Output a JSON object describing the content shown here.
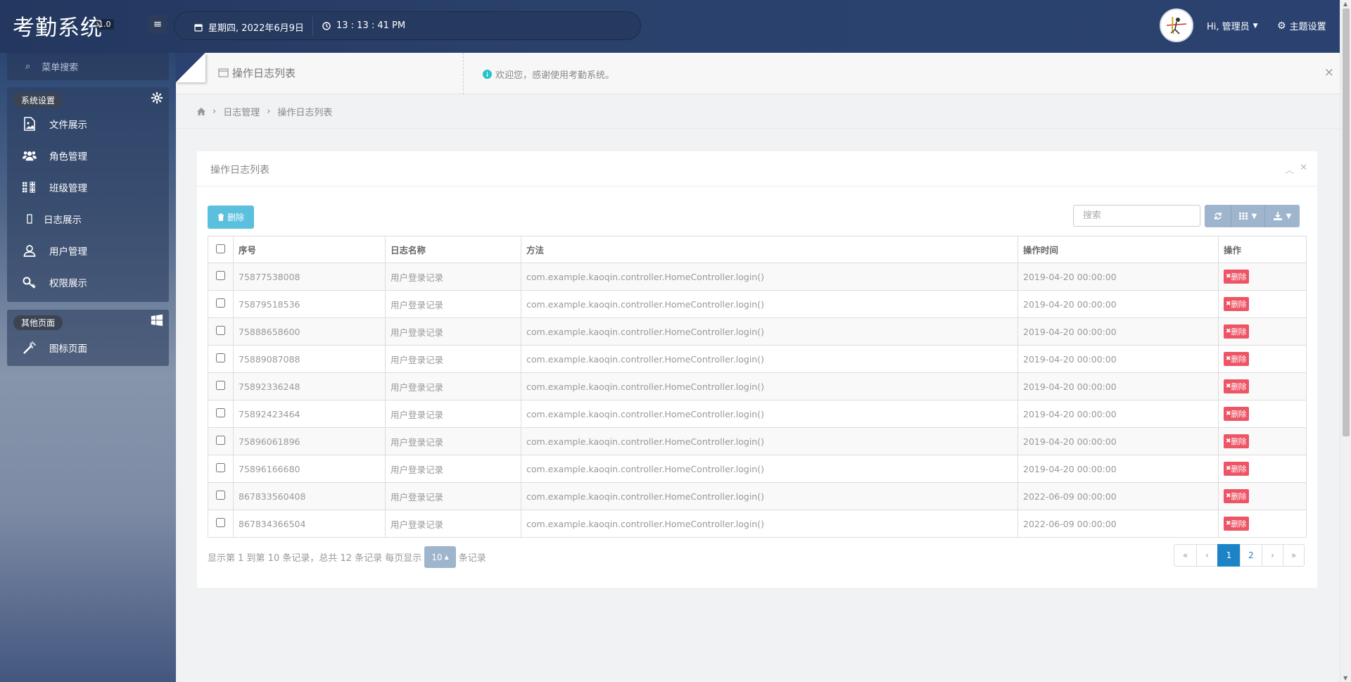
{
  "app": {
    "title": "考勤系统",
    "version": "1.0"
  },
  "header": {
    "menu_toggle_icon": "hamburger-icon",
    "date": "星期四, 2022年6月9日",
    "time": "13 : 13 : 41 PM",
    "user_greeting": "Hi, 管理员",
    "theme_label": "主题设置"
  },
  "sidebar": {
    "search_label": "菜单搜索",
    "groups": [
      {
        "tag": "系统设置",
        "icon": "gear-icon",
        "items": [
          {
            "label": "文件展示",
            "icon": "image-file-icon"
          },
          {
            "label": "角色管理",
            "icon": "users-icon"
          },
          {
            "label": "班级管理",
            "icon": "grid-icon"
          },
          {
            "label": "日志展示",
            "icon": "log-icon"
          },
          {
            "label": "用户管理",
            "icon": "user-icon"
          },
          {
            "label": "权限展示",
            "icon": "key-icon"
          }
        ]
      },
      {
        "tag": "其他页面",
        "icon": "windows-icon",
        "items": [
          {
            "label": "图标页面",
            "icon": "magic-wand-icon"
          }
        ]
      }
    ]
  },
  "tabs": {
    "active_label": "操作日志列表",
    "welcome_text": "欢迎您，感谢使用考勤系统。",
    "close_glyph": "×"
  },
  "breadcrumb": {
    "section": "日志管理",
    "current": "操作日志列表"
  },
  "panel": {
    "title": "操作日志列表",
    "delete_label": "删除",
    "search_placeholder": "搜索"
  },
  "table": {
    "columns": [
      "序号",
      "日志名称",
      "方法",
      "操作时间",
      "操作"
    ],
    "rows": [
      {
        "id": "75877538008",
        "name": "用户登录记录",
        "method": "com.example.kaoqin.controller.HomeController.login()",
        "time": "2019-04-20 00:00:00"
      },
      {
        "id": "75879518536",
        "name": "用户登录记录",
        "method": "com.example.kaoqin.controller.HomeController.login()",
        "time": "2019-04-20 00:00:00"
      },
      {
        "id": "75888658600",
        "name": "用户登录记录",
        "method": "com.example.kaoqin.controller.HomeController.login()",
        "time": "2019-04-20 00:00:00"
      },
      {
        "id": "75889087088",
        "name": "用户登录记录",
        "method": "com.example.kaoqin.controller.HomeController.login()",
        "time": "2019-04-20 00:00:00"
      },
      {
        "id": "75892336248",
        "name": "用户登录记录",
        "method": "com.example.kaoqin.controller.HomeController.login()",
        "time": "2019-04-20 00:00:00"
      },
      {
        "id": "75892423464",
        "name": "用户登录记录",
        "method": "com.example.kaoqin.controller.HomeController.login()",
        "time": "2019-04-20 00:00:00"
      },
      {
        "id": "75896061896",
        "name": "用户登录记录",
        "method": "com.example.kaoqin.controller.HomeController.login()",
        "time": "2019-04-20 00:00:00"
      },
      {
        "id": "75896166680",
        "name": "用户登录记录",
        "method": "com.example.kaoqin.controller.HomeController.login()",
        "time": "2019-04-20 00:00:00"
      },
      {
        "id": "867833560408",
        "name": "用户登录记录",
        "method": "com.example.kaoqin.controller.HomeController.login()",
        "time": "2022-06-09 00:00:00"
      },
      {
        "id": "867834366504",
        "name": "用户登录记录",
        "method": "com.example.kaoqin.controller.HomeController.login()",
        "time": "2022-06-09 00:00:00"
      }
    ],
    "row_action_label": "删除"
  },
  "pagination": {
    "info_prefix": "显示第 1 到第 10 条记录，总共 12 条记录 每页显示",
    "page_size": "10",
    "info_suffix": "条记录",
    "first": "«",
    "prev": "‹",
    "pages": [
      "1",
      "2"
    ],
    "next": "›",
    "last": "»"
  },
  "colors": {
    "header_bg": "#2a416c",
    "accent_info": "#5bc0de",
    "danger": "#ed5565",
    "primary": "#1c84c6",
    "toolbar_btn": "#9eb5cd"
  }
}
